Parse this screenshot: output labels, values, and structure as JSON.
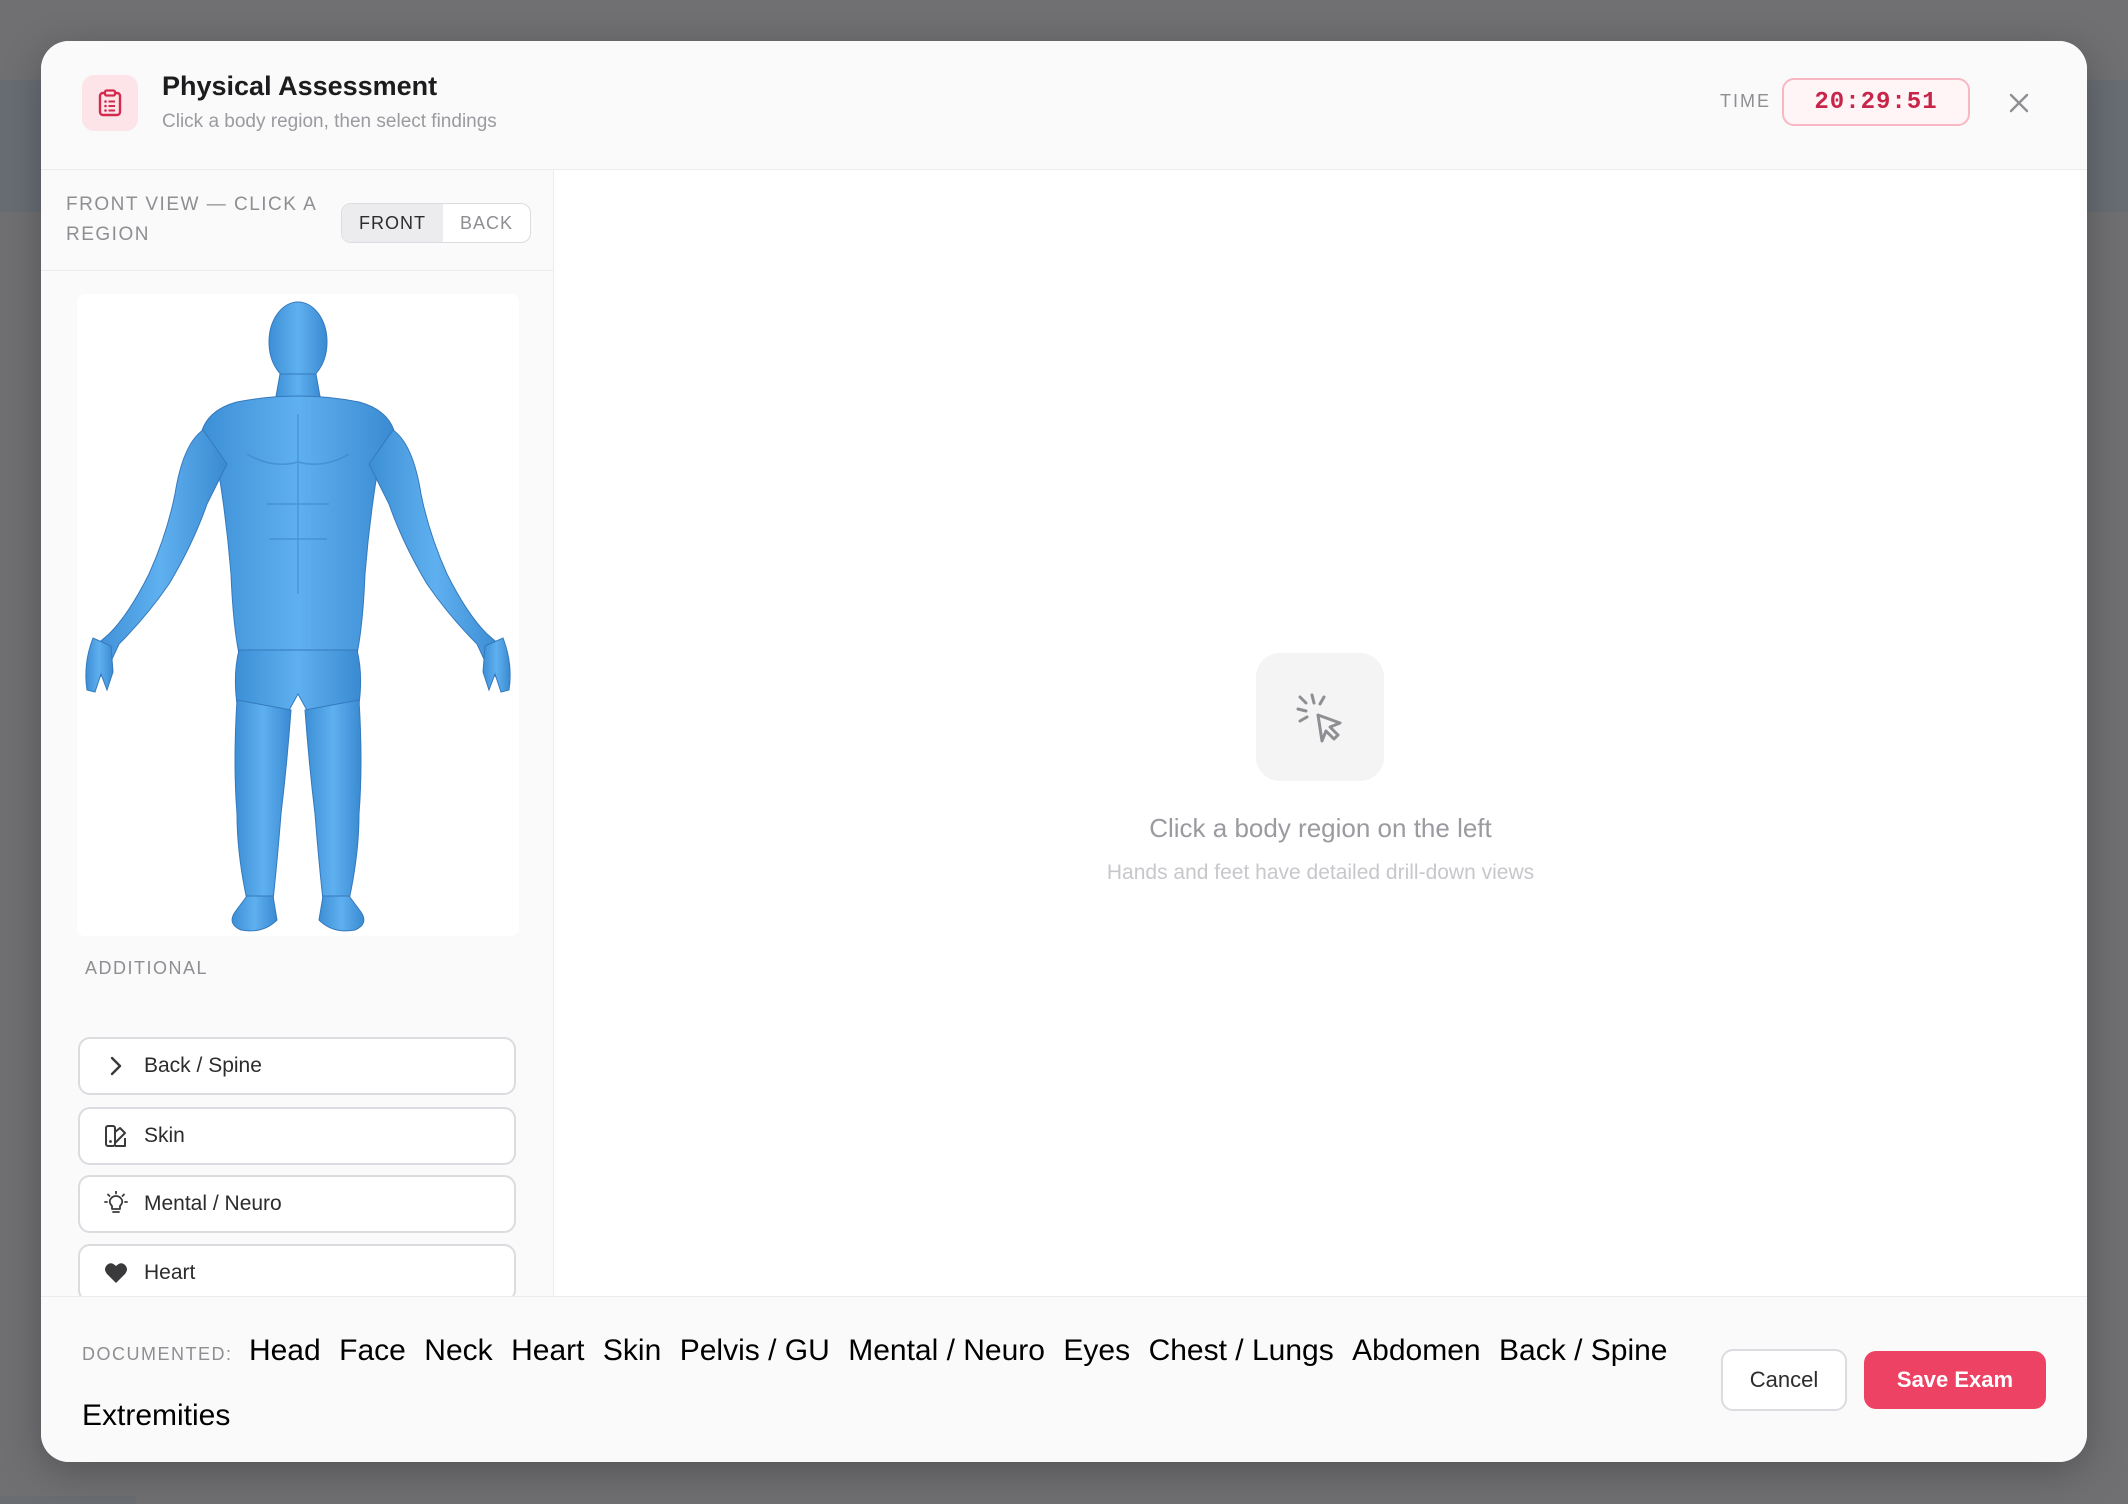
{
  "header": {
    "title": "Physical Assessment",
    "subtitle": "Click a body region, then select findings",
    "time_label": "TIME",
    "time_value": "20:29:51",
    "icon": "clipboard-icon",
    "accent_color": "#ee4264"
  },
  "left_panel": {
    "view_label": "FRONT VIEW — CLICK A REGION",
    "view_toggle": {
      "front": "FRONT",
      "back": "BACK",
      "selected": "FRONT"
    },
    "model_color": "#4ba3e6",
    "additional_label": "ADDITIONAL",
    "regions": [
      {
        "label": "Back / Spine",
        "icon": "chevron-right-icon"
      },
      {
        "label": "Skin",
        "icon": "swatch-icon"
      },
      {
        "label": "Mental / Neuro",
        "icon": "lightbulb-icon"
      },
      {
        "label": "Heart",
        "icon": "heart-icon"
      }
    ]
  },
  "content": {
    "empty_icon": "cursor-click-icon",
    "empty_title": "Click a body region on the left",
    "empty_subtitle": "Hands and feet have detailed drill-down views"
  },
  "footer": {
    "documented_label": "DOCUMENTED:",
    "documented": [
      "Head",
      "Face",
      "Neck",
      "Heart",
      "Skin",
      "Pelvis / GU",
      "Mental / Neuro",
      "Eyes",
      "Chest / Lungs",
      "Abdomen",
      "Back / Spine",
      "Extremities"
    ],
    "cancel_label": "Cancel",
    "save_label": "Save Exam"
  }
}
